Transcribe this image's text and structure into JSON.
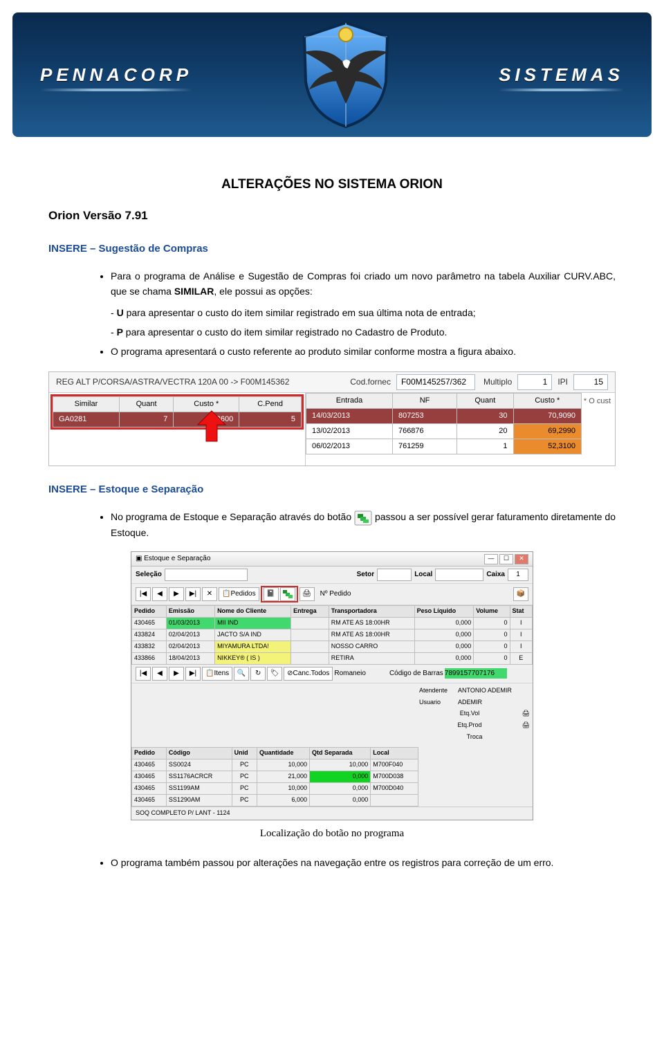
{
  "banner": {
    "brand_left": "PENNACORP",
    "brand_right": "SISTEMAS"
  },
  "title": "ALTERAÇÕES NO SISTEMA ORION",
  "version_heading": "Orion Versão 7.91",
  "section1": {
    "heading": "INSERE – Sugestão de Compras",
    "bullet1": "Para o programa de Análise e Sugestão de Compras foi criado um novo parâmetro na tabela Auxiliar CURV.ABC, que se chama ",
    "bullet1_bold": "SIMILAR",
    "bullet1_after": ", ele possui as opções:",
    "opt_u_pre": "- ",
    "opt_u_bold": "U",
    "opt_u": " para apresentar o custo do item similar registrado em sua última nota de entrada;",
    "opt_p_pre": "- ",
    "opt_p_bold": "P",
    "opt_p": " para apresentar o custo do item similar registrado no Cadastro de Produto.",
    "bullet2": "O programa apresentará o custo referente ao produto similar conforme mostra a figura abaixo."
  },
  "shot1": {
    "desc": "REG ALT P/CORSA/ASTRA/VECTRA 120A 00 -> F00M145362",
    "codfornec_lbl": "Cod.fornec",
    "codfornec": "F00M145257/362",
    "mult_lbl": "Multiplo",
    "mult": "1",
    "ipi_lbl": "IPI",
    "ipi": "15",
    "left_headers": [
      "Similar",
      "Quant",
      "Custo *",
      "C.Pend"
    ],
    "left_row": {
      "similar": "GA0281",
      "quant": "7",
      "custo": "53,3600",
      "cpend": "5"
    },
    "right_headers": [
      "Entrada",
      "NF",
      "Quant",
      "Custo *"
    ],
    "right_rows": [
      {
        "entrada": "14/03/2013",
        "nf": "807253",
        "quant": "30",
        "custo": "70,9090"
      },
      {
        "entrada": "13/02/2013",
        "nf": "766876",
        "quant": "20",
        "custo": "69,2990"
      },
      {
        "entrada": "06/02/2013",
        "nf": "761259",
        "quant": "1",
        "custo": "52,3100"
      }
    ],
    "ocust": "* O cust"
  },
  "section2": {
    "heading": "INSERE – Estoque e Separação",
    "bullet1_pre": "No programa de Estoque e Separação através do botão ",
    "bullet1_post": " passou a ser possível gerar faturamento diretamente do Estoque."
  },
  "shot2": {
    "title": "Estoque e Separação",
    "selecao": "Seleção",
    "setor": "Setor",
    "local": "Local",
    "caixa_lbl": "Caixa",
    "caixa": "1",
    "pedidos_lbl": "Pedidos",
    "nped_lbl": "Nº Pedido",
    "grid1_headers": [
      "Pedido",
      "Emissão",
      "Nome do Cliente",
      "Entrega",
      "Transportadora",
      "Peso Líquido",
      "Volume",
      "Stat"
    ],
    "grid1_rows": [
      {
        "pedido": "430465",
        "emissao": "01/03/2013",
        "nome": "MII IND",
        "transp": "RM ATE AS 18:00HR",
        "peso": "0,000",
        "vol": "0",
        "stat": "I"
      },
      {
        "pedido": "433824",
        "emissao": "02/04/2013",
        "nome": "JACTO S/A  IND",
        "transp": "RM ATE AS 18:00HR",
        "peso": "0,000",
        "vol": "0",
        "stat": "I"
      },
      {
        "pedido": "433832",
        "emissao": "02/04/2013",
        "nome": "MIYAMURA LTDA!",
        "transp": "NOSSO CARRO",
        "peso": "0,000",
        "vol": "0",
        "stat": "I"
      },
      {
        "pedido": "433866",
        "emissao": "18/04/2013",
        "nome": "NIKKEY® ( IS )",
        "transp": "RETIRA",
        "peso": "0,000",
        "vol": "0",
        "stat": "E"
      }
    ],
    "itens_lbl": "Itens",
    "canc_lbl": "Canc.Todos",
    "romaneio_lbl": "Romaneio",
    "codbarras_lbl": "Código de Barras",
    "codbarras": "7899157707176",
    "grid2_headers": [
      "Pedido",
      "Código",
      "Unid",
      "Quantidade",
      "Qtd Separada",
      "Local"
    ],
    "grid2_rows": [
      {
        "pedido": "430465",
        "codigo": "SS0024",
        "unid": "PC",
        "qtd": "10,000",
        "sep": "10,000",
        "local": "M700F040"
      },
      {
        "pedido": "430465",
        "codigo": "SS1176ACRCR",
        "unid": "PC",
        "qtd": "21,000",
        "sep": "0,000",
        "local": "M700D038"
      },
      {
        "pedido": "430465",
        "codigo": "SS1199AM",
        "unid": "PC",
        "qtd": "10,000",
        "sep": "0,000",
        "local": "M700D040"
      },
      {
        "pedido": "430465",
        "codigo": "SS1290AM",
        "unid": "PC",
        "qtd": "6,000",
        "sep": "0,000",
        "local": ""
      }
    ],
    "atendente_lbl": "Atendente",
    "atendente": "ANTONIO ADEMIR",
    "usuario_lbl": "Usuario",
    "usuario": "ADEMIR",
    "etqvol": "Etq.Vol",
    "etqprod": "Etq.Prod",
    "troca": "Troca",
    "footer": "SOQ COMPLETO P/ LANT - 1124"
  },
  "caption2": "Localização do botão no programa",
  "last_bullet": "O programa também passou por alterações na navegação entre os registros para correção de um erro."
}
